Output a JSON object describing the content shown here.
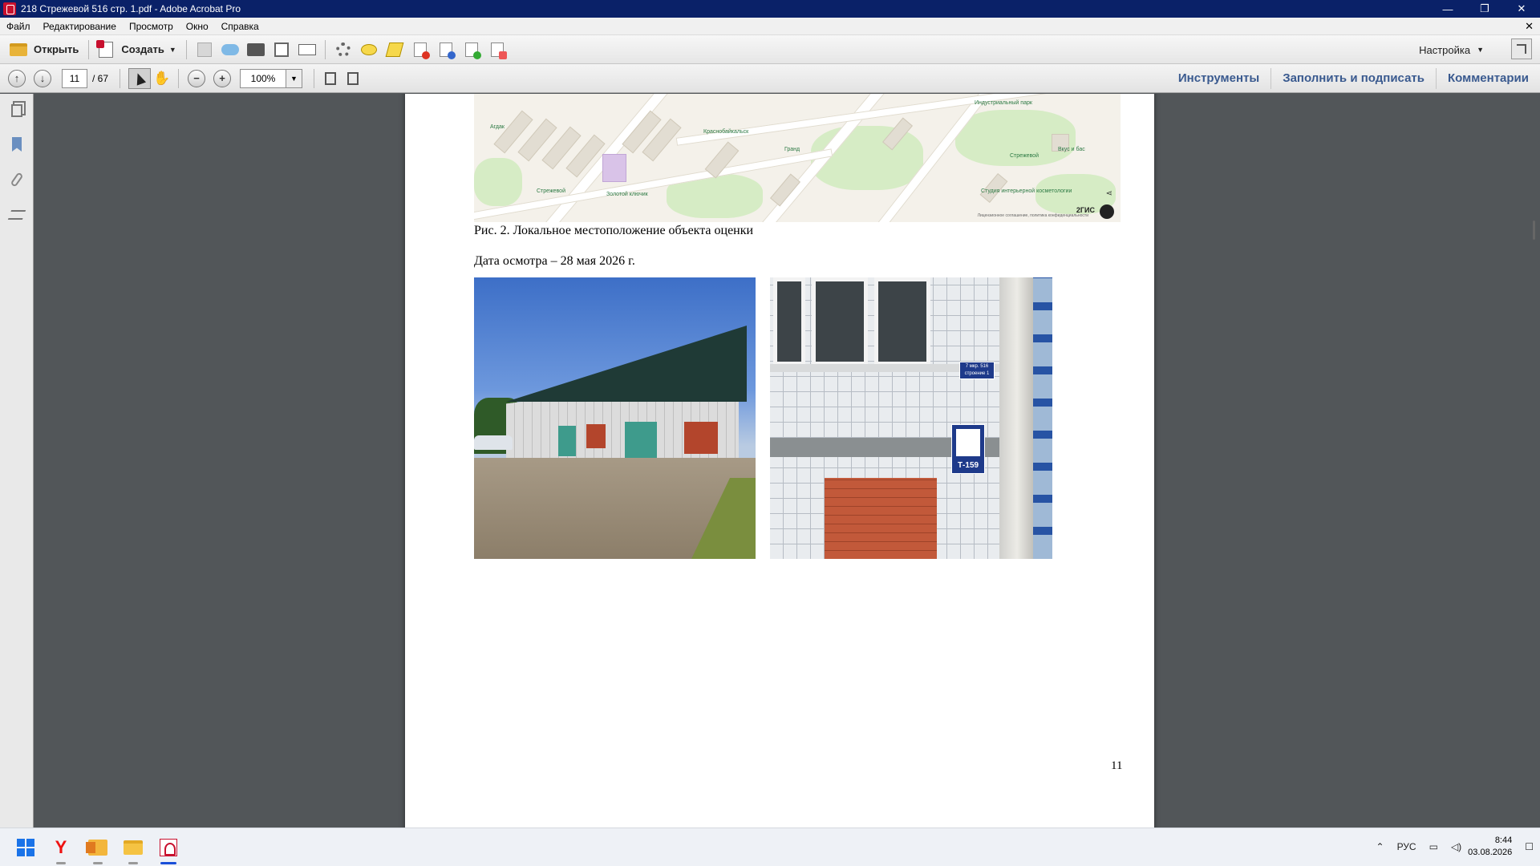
{
  "window": {
    "title": "218 Стрежевой 516 стр. 1.pdf - Adobe Acrobat Pro",
    "minimize": "—",
    "restore": "❐",
    "close": "✕"
  },
  "menu": {
    "items": [
      "Файл",
      "Редактирование",
      "Просмотр",
      "Окно",
      "Справка"
    ],
    "doc_close": "✕"
  },
  "toolbar": {
    "open_label": "Открыть",
    "create_label": "Создать",
    "settings_label": "Настройка"
  },
  "navigation": {
    "current_page": "11",
    "total_pages": "/ 67",
    "zoom": "100%"
  },
  "right_tabs": {
    "tools": "Инструменты",
    "fill_sign": "Заполнить и подписать",
    "comments": "Комментарии"
  },
  "document": {
    "map_caption": "Рис. 2. Локальное местоположение объекта оценки",
    "inspection_date": "Дата осмотра – 28 мая 2026 г.",
    "page_number": "11",
    "map": {
      "pois": [
        "Агдак",
        "Краснобайкальск",
        "Гранд",
        "Стрежевой",
        "Золотой ключик",
        "Индустриальный парк",
        "Вкус и бас",
        "Стрежевой",
        "Студия интерьерной косметологии"
      ],
      "brand": "2ГИС",
      "copyright": "Лицензионное соглашение, политика конфиденциальности"
    },
    "photo2_sign1": "7 мкр. 516 строение 1",
    "photo2_sign2": "Т-159"
  },
  "taskbar": {
    "lang": "РУС",
    "time": "8:44",
    "date": "03.08.2026"
  }
}
